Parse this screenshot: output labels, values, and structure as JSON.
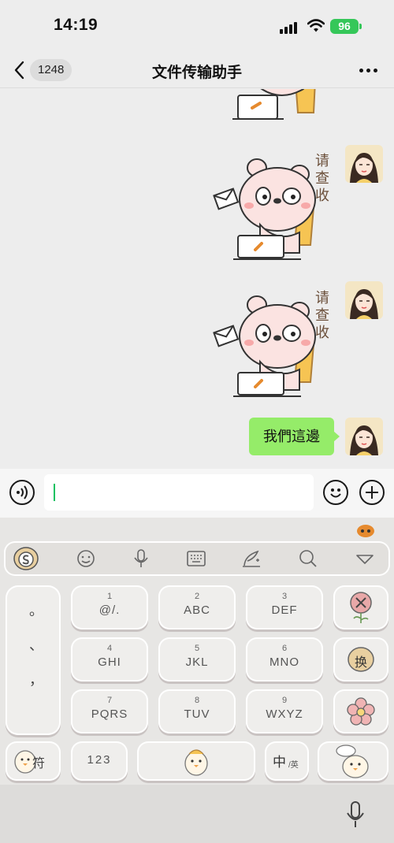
{
  "status_bar": {
    "time": "14:19",
    "battery": "96"
  },
  "nav": {
    "unread_count": "1248",
    "title": "文件传输助手"
  },
  "chat": {
    "sticker_text": "请查收",
    "last_message": "我們這邊"
  },
  "keyboard": {
    "punct_keys": [
      "。",
      "、",
      "，"
    ],
    "keys": [
      {
        "num": "1",
        "letters": "@/."
      },
      {
        "num": "2",
        "letters": "ABC"
      },
      {
        "num": "3",
        "letters": "DEF"
      },
      {
        "num": "4",
        "letters": "GHI"
      },
      {
        "num": "5",
        "letters": "JKL"
      },
      {
        "num": "6",
        "letters": "MNO"
      },
      {
        "num": "7",
        "letters": "PQRS"
      },
      {
        "num": "8",
        "letters": "TUV"
      },
      {
        "num": "9",
        "letters": "WXYZ"
      }
    ],
    "switch_key": "换",
    "symbol_key": "符",
    "number_key": "123",
    "lang_key": "中",
    "lang_sub": "/英"
  },
  "colors": {
    "bubble_green": "#95ec69",
    "battery_green": "#35c759",
    "caret_green": "#07c160"
  },
  "icons": [
    "back-chevron-icon",
    "more-dots-icon",
    "voice-icon",
    "emoji-icon",
    "plus-icon",
    "mic-icon",
    "keyboard-icon",
    "handwriting-icon",
    "search-icon",
    "collapse-icon",
    "delete-icon"
  ]
}
